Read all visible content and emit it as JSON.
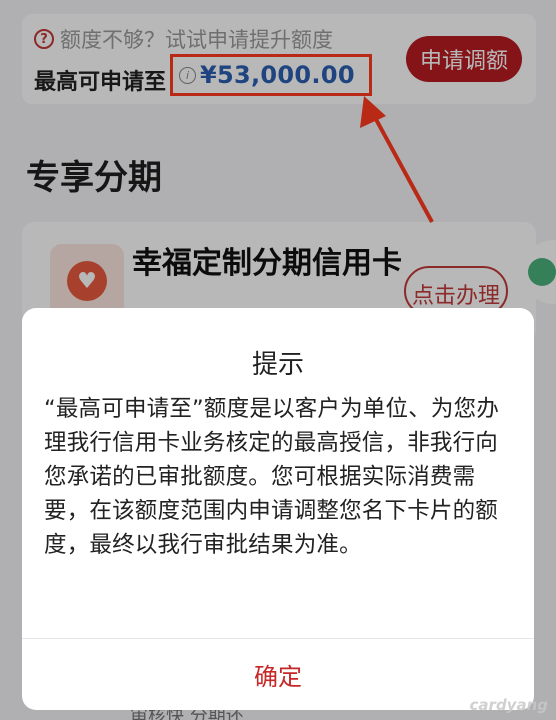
{
  "quota": {
    "hint_icon": "question-circle-icon",
    "hint": "额度不够？试试申请提升额度",
    "label": "最高可申请至",
    "info_icon": "info-icon",
    "amount": "¥53,000.00",
    "apply_button": "申请调额"
  },
  "section": {
    "title": "专享分期"
  },
  "product": {
    "icon": "heart-icon",
    "name": "幸福定制分期信用卡",
    "action": "点击办理"
  },
  "bottom_peek": "审核快   分期还",
  "dialog": {
    "title": "提示",
    "body": "“最高可申请至”额度是以客户为单位、为您办理我行信用卡业务核定的最高授信，非我行向您承诺的已审批额度。您可根据实际消费需要，在该额度范围内申请调整您名下卡片的额度，最终以我行审批结果为准。",
    "confirm": "确定"
  },
  "watermark": "cardyang",
  "colors": {
    "accent_red": "#b81c22",
    "amount_blue": "#2b5fb0",
    "highlight_box": "#ff3b1f"
  }
}
